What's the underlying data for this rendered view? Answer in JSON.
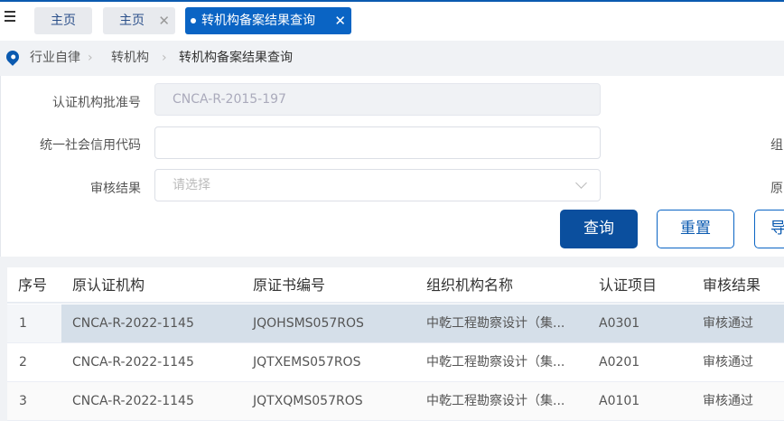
{
  "tabs": [
    {
      "label": "主页",
      "closable": false
    },
    {
      "label": "主页",
      "closable": true
    },
    {
      "label": "转机构备案结果查询",
      "closable": true,
      "active": true
    }
  ],
  "breadcrumb": [
    "行业自律",
    "转机构",
    "转机构备案结果查询"
  ],
  "form": {
    "approval_no_label": "认证机构批准号",
    "approval_no_value": "CNCA-R-2015-197",
    "credit_code_label": "统一社会信用代码",
    "credit_code_value": "",
    "result_label": "审核结果",
    "result_placeholder": "请选择",
    "right_label_1": "组",
    "right_label_2": "原",
    "search_button": "查询",
    "reset_button": "重置",
    "export_button": "导"
  },
  "table": {
    "headers": [
      "序号",
      "原认证机构",
      "原证书编号",
      "组织机构名称",
      "认证项目",
      "审核结果"
    ],
    "rows": [
      [
        "1",
        "CNCA-R-2022-1145",
        "JQOHSMS057ROS",
        "中乾工程勘察设计（集...",
        "A0301",
        "审核通过"
      ],
      [
        "2",
        "CNCA-R-2022-1145",
        "JQTXEMS057ROS",
        "中乾工程勘察设计（集...",
        "A0201",
        "审核通过"
      ],
      [
        "3",
        "CNCA-R-2022-1145",
        "JQTXQMS057ROS",
        "中乾工程勘察设计（集...",
        "A0101",
        "审核通过"
      ]
    ]
  },
  "colors": {
    "primary": "#0b4f9e",
    "tab_active": "#0a64c4",
    "row_selected": "#d5dfe9"
  }
}
